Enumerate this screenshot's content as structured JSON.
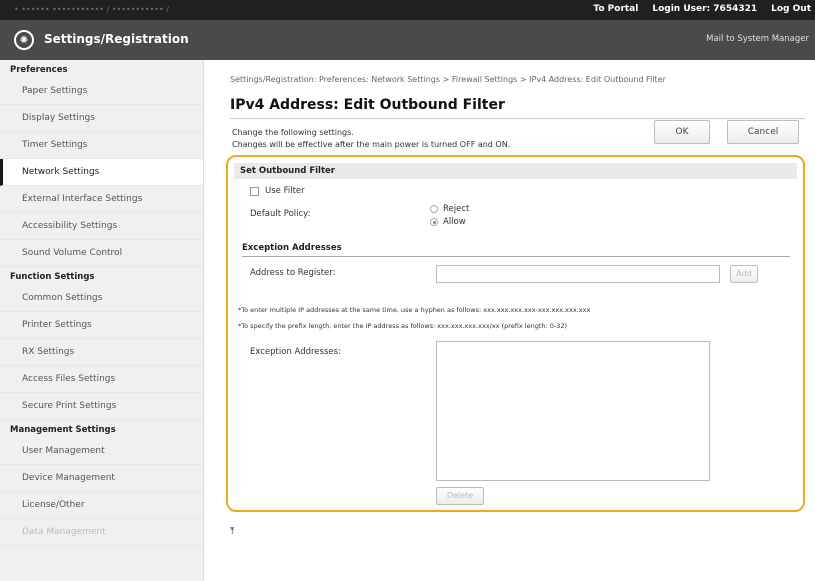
{
  "topbar": {
    "url_text": "• ••••••  ••••••••••• / ••••••••••• /",
    "to_portal": "To Portal",
    "login_label": "Login User:",
    "login_user": "7654321",
    "logout": "Log Out"
  },
  "header": {
    "title": "Settings/Registration",
    "mail_link": "Mail to System Manager"
  },
  "sidebar": {
    "groups": [
      {
        "label": "Preferences",
        "items": [
          {
            "label": "Paper Settings"
          },
          {
            "label": "Display Settings"
          },
          {
            "label": "Timer Settings"
          },
          {
            "label": "Network Settings"
          },
          {
            "label": "External Interface Settings"
          },
          {
            "label": "Accessibility Settings"
          },
          {
            "label": "Sound Volume Control"
          }
        ]
      },
      {
        "label": "Function Settings",
        "items": [
          {
            "label": "Common Settings"
          },
          {
            "label": "Printer Settings"
          },
          {
            "label": "RX Settings"
          },
          {
            "label": "Access Files Settings"
          },
          {
            "label": "Secure Print Settings"
          }
        ]
      },
      {
        "label": "Management Settings",
        "items": [
          {
            "label": "User Management"
          },
          {
            "label": "Device Management"
          },
          {
            "label": "License/Other"
          },
          {
            "label": "Data Management"
          }
        ]
      }
    ],
    "active_item": "Network Settings"
  },
  "main": {
    "breadcrumb": "Settings/Registration: Preferences: Network Settings > Firewall Settings > IPv4 Address: Edit Outbound Filter",
    "page_title": "IPv4 Address: Edit Outbound Filter",
    "note_line1": "Change the following settings.",
    "note_line2": "Changes will be effective after the main power is turned OFF and ON.",
    "ok_label": "OK",
    "cancel_label": "Cancel",
    "section_title": "Set Outbound Filter",
    "use_filter_label": "Use Filter",
    "use_filter_checked": false,
    "default_policy_label": "Default Policy:",
    "policy_options": [
      "Reject",
      "Allow"
    ],
    "policy_selected": "Allow",
    "exception_heading": "Exception Addresses",
    "address_register_label": "Address to Register:",
    "address_register_value": "",
    "add_label": "Add",
    "hint1": "*To enter multiple IP addresses at the same time, use a hyphen as follows: xxx.xxx.xxx.xxx-xxx.xxx.xxx.xxx",
    "hint2": "*To specify the prefix length, enter the IP address as follows: xxx.xxx.xxx.xxx/xx (prefix length: 0-32)",
    "exception_list_label": "Exception Addresses:",
    "exception_list_items": [],
    "delete_label": "Delete",
    "to_top_glyph": "⤒"
  },
  "colors": {
    "highlight": "#f0a820",
    "header_bg": "#4a4a4a",
    "topbar_bg": "#202020"
  }
}
